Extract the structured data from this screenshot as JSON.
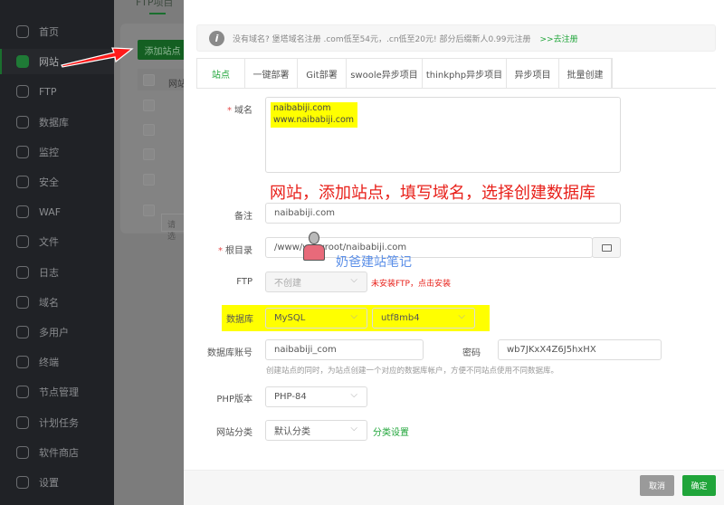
{
  "sidebar": {
    "items": [
      {
        "label": "首页",
        "icon": "home-icon"
      },
      {
        "label": "网站",
        "icon": "website-icon",
        "active": true
      },
      {
        "label": "FTP",
        "icon": "ftp-icon"
      },
      {
        "label": "数据库",
        "icon": "database-icon"
      },
      {
        "label": "监控",
        "icon": "monitor-icon"
      },
      {
        "label": "安全",
        "icon": "shield-icon"
      },
      {
        "label": "WAF",
        "icon": "waf-icon"
      },
      {
        "label": "文件",
        "icon": "folder-icon"
      },
      {
        "label": "日志",
        "icon": "log-icon"
      },
      {
        "label": "域名",
        "icon": "globe-icon"
      },
      {
        "label": "多用户",
        "icon": "users-icon"
      },
      {
        "label": "终端",
        "icon": "terminal-icon"
      },
      {
        "label": "节点管理",
        "icon": "node-icon"
      },
      {
        "label": "计划任务",
        "icon": "calendar-icon"
      },
      {
        "label": "软件商店",
        "icon": "store-icon"
      },
      {
        "label": "设置",
        "icon": "settings-icon"
      }
    ]
  },
  "background": {
    "tab": "FTP项目",
    "add_site": "添加站点",
    "col_site": "网站",
    "search_placeholder": "请选"
  },
  "notice": {
    "text": "没有域名? 堡塔域名注册 .com低至54元，.cn低至20元! 部分后缀新人0.99元注册",
    "link": ">>去注册"
  },
  "tabs": [
    "站点",
    "一键部署",
    "Git部署",
    "swoole异步项目",
    "thinkphp异步项目",
    "异步项目",
    "批量创建"
  ],
  "form": {
    "domain_label": "域名",
    "domain_value": [
      "naibabiji.com",
      "www.naibabiji.com"
    ],
    "remark_label": "备注",
    "remark_value": "naibabiji.com",
    "root_label": "根目录",
    "root_value": "/www/wwwroot/naibabiji.com",
    "ftp_label": "FTP",
    "ftp_value": "不创建",
    "ftp_warning": "未安装FTP，点击安装",
    "db_label": "数据库",
    "db_type": "MySQL",
    "db_charset": "utf8mb4",
    "db_account_label": "数据库账号",
    "db_account_value": "naibabiji_com",
    "password_label": "密码",
    "password_value": "wb7JKxX4Z6J5hxHX",
    "db_hint": "创建站点的同时，为站点创建一个对应的数据库帐户，方便不同站点使用不同数据库。",
    "php_label": "PHP版本",
    "php_value": "PHP-84",
    "category_label": "网站分类",
    "category_value": "默认分类",
    "category_link": "分类设置"
  },
  "annotation": "网站，添加站点，填写域名，选择创建数据库",
  "watermark": "奶爸建站笔记",
  "footer": {
    "cancel": "取消",
    "confirm": "确定"
  },
  "colors": {
    "accent": "#20a53a",
    "annotation": "#e8201a",
    "highlight": "#ffff00"
  }
}
